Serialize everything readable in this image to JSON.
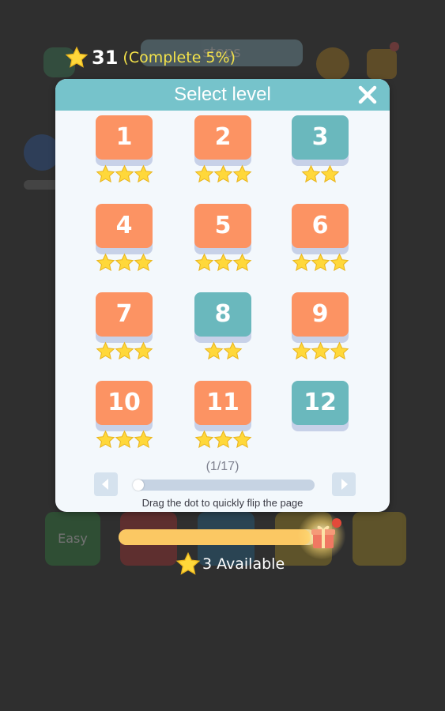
{
  "header": {
    "star_count": "31",
    "completion": "(Complete 5%)",
    "background_title": "steps"
  },
  "background": {
    "easy_label": "Easy"
  },
  "dialog": {
    "title": "Select level",
    "close_icon": "close-icon",
    "levels": [
      {
        "number": "1",
        "stars": 3,
        "color": "orange"
      },
      {
        "number": "2",
        "stars": 3,
        "color": "orange"
      },
      {
        "number": "3",
        "stars": 2,
        "color": "teal"
      },
      {
        "number": "4",
        "stars": 3,
        "color": "orange"
      },
      {
        "number": "5",
        "stars": 3,
        "color": "orange"
      },
      {
        "number": "6",
        "stars": 3,
        "color": "orange"
      },
      {
        "number": "7",
        "stars": 3,
        "color": "orange"
      },
      {
        "number": "8",
        "stars": 2,
        "color": "teal"
      },
      {
        "number": "9",
        "stars": 3,
        "color": "orange"
      },
      {
        "number": "10",
        "stars": 3,
        "color": "orange"
      },
      {
        "number": "11",
        "stars": 3,
        "color": "orange"
      },
      {
        "number": "12",
        "stars": 0,
        "color": "teal"
      }
    ],
    "page_indicator": "(1/17)",
    "slider_position": 0.0,
    "hint": "Drag the dot to quickly flip the page"
  },
  "bottom": {
    "available_text": "3 Available",
    "progress_fraction": 0.97
  },
  "colors": {
    "orange_tile": "#fc9363",
    "teal_tile": "#6ab8bd",
    "header_teal": "#76c3cb",
    "star_yellow": "#ffd83a",
    "progress_yellow": "#fbc863"
  }
}
